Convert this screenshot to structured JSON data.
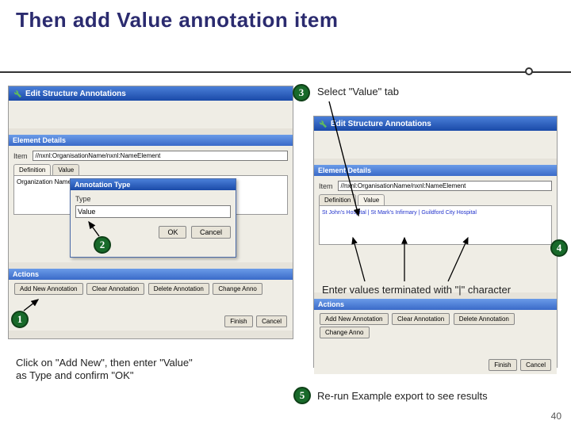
{
  "title": "Then add Value annotation item",
  "ss1": {
    "window_title": "Edit Structure Annotations",
    "element_details": "Element Details",
    "item_label": "Item",
    "item_path": "//nxnl:OrganisationName/nxnl:NameElement",
    "tab_definition": "Definition",
    "tab_value": "Value",
    "def_text": "Organization Name",
    "actions_title": "Actions",
    "btn_add": "Add New Annotation",
    "btn_clear": "Clear Annotation",
    "btn_delete": "Delete Annotation",
    "btn_change": "Change Anno",
    "btn_finish": "Finish",
    "btn_cancel": "Cancel"
  },
  "dlg": {
    "title": "Annotation Type",
    "type_label": "Type",
    "type_value": "Value",
    "ok": "OK",
    "cancel": "Cancel"
  },
  "ss2": {
    "window_title": "Edit Structure Annotations",
    "element_details": "Element Details",
    "item_label": "Item",
    "item_path": "//nxnl:OrganisationName/nxnl:NameElement",
    "tab_definition": "Definition",
    "tab_value": "Value",
    "values_text": "St John's Hospital | St Mark's Infirmary | Guildford City Hospital",
    "actions_title": "Actions",
    "btn_add": "Add New Annotation",
    "btn_clear": "Clear Annotation",
    "btn_delete": "Delete Annotation",
    "btn_change": "Change Anno",
    "btn_finish": "Finish",
    "btn_cancel": "Cancel"
  },
  "callouts": {
    "n1": "1",
    "n2": "2",
    "n3": "3",
    "n4": "4",
    "n5": "5",
    "t1": "Click on \"Add New\", then enter \"Value\" as Type and confirm \"OK\"",
    "t3": "Select \"Value\" tab",
    "t4": "Enter values terminated with \"|\" character",
    "t5": "Re-run Example export to see results"
  },
  "page_number": "40"
}
